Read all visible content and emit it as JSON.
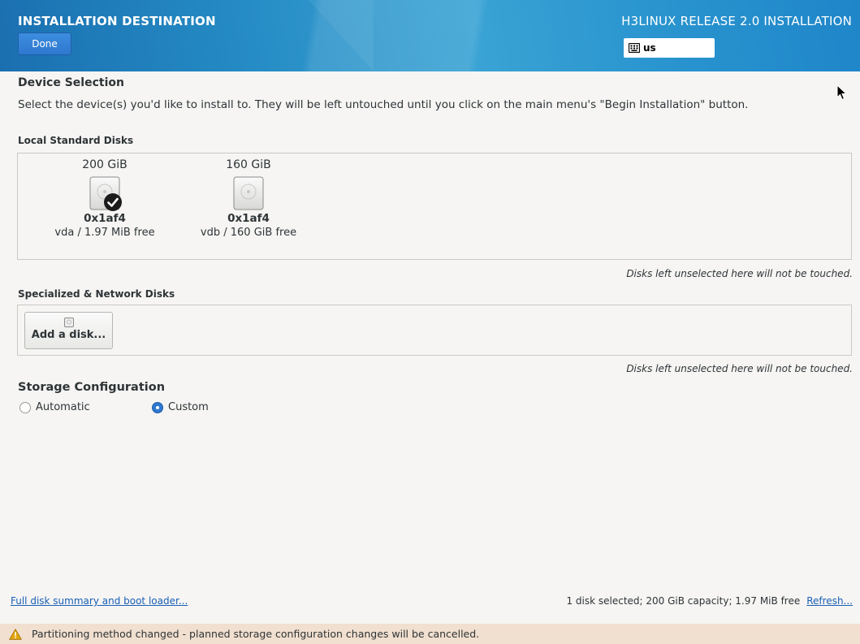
{
  "header": {
    "spoke_title": "INSTALLATION DESTINATION",
    "done_label": "Done",
    "product_title": "H3LINUX RELEASE 2.0 INSTALLATION",
    "keyboard_layout": "us",
    "keyboard_icon": "keyboard-icon"
  },
  "device_selection": {
    "title": "Device Selection",
    "description": "Select the device(s) you'd like to install to.  They will be left untouched until you click on the main menu's \"Begin Installation\" button."
  },
  "local_disks": {
    "title": "Local Standard Disks",
    "disks": [
      {
        "size": "200 GiB",
        "model": "0x1af4",
        "detail": "vda / 1.97 MiB free",
        "selected": true,
        "icon": "hard-disk-icon"
      },
      {
        "size": "160 GiB",
        "model": "0x1af4",
        "detail": "vdb / 160 GiB free",
        "selected": false,
        "icon": "hard-disk-icon"
      }
    ],
    "note": "Disks left unselected here will not be touched."
  },
  "network_disks": {
    "title": "Specialized & Network Disks",
    "add_label": "Add a disk...",
    "note": "Disks left unselected here will not be touched."
  },
  "storage": {
    "title": "Storage Configuration",
    "options": [
      {
        "label": "Automatic",
        "selected": false
      },
      {
        "label": "Custom",
        "selected": true
      }
    ]
  },
  "footer": {
    "summary_link": "Full disk summary and boot loader...",
    "status": "1 disk selected; 200 GiB capacity; 1.97 MiB free",
    "refresh_link": "Refresh...",
    "warning": "Partitioning method changed - planned storage configuration changes will be cancelled.",
    "warning_icon": "warning-icon"
  },
  "colors": {
    "header_blue": "#2388c2",
    "accent": "#2f78cf",
    "warning_bg": "#f1dfcf"
  }
}
